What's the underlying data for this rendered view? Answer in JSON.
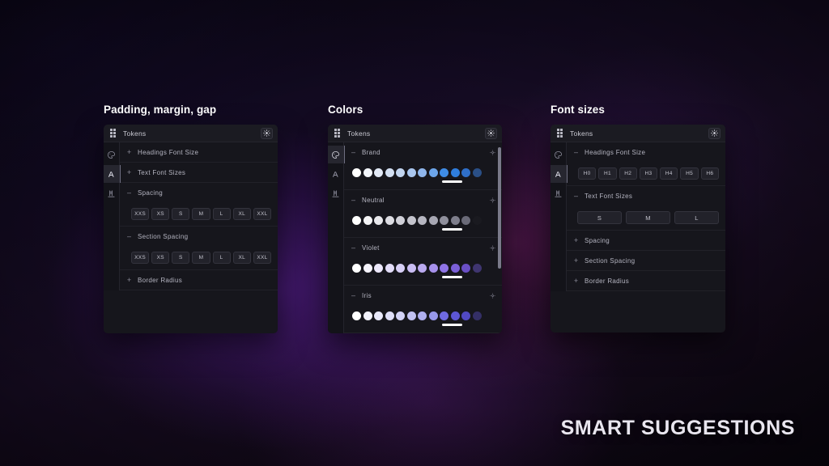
{
  "footer": {
    "text": "SMART SUGGESTIONS"
  },
  "theme": {
    "accent": "#ffffff",
    "panel_bg": "#16161c",
    "panel_header_bg": "#1b1b22",
    "rail_bg": "#131319",
    "border": "#212128",
    "text_primary": "#c9c9d2",
    "text_secondary": "#b4b4c0"
  },
  "panels": [
    {
      "caption": "Padding, margin, gap",
      "header": {
        "title": "Tokens",
        "grip_icon": "grid-dots-icon",
        "theme_icon": "sun-brightness-icon"
      },
      "rail": [
        {
          "icon": "palette-icon",
          "active": false
        },
        {
          "icon": "font-size-icon",
          "active": true
        },
        {
          "icon": "spacing-ruler-icon",
          "active": false
        }
      ],
      "rows": [
        {
          "toggle": "+",
          "label": "Headings Font Size"
        },
        {
          "toggle": "+",
          "label": "Text Font Sizes"
        },
        {
          "toggle": "–",
          "label": "Spacing"
        },
        {
          "toggle": "–",
          "label": "Section Spacing"
        },
        {
          "toggle": "+",
          "label": "Border Radius"
        }
      ],
      "spacing_chips": [
        "XXS",
        "XS",
        "S",
        "M",
        "L",
        "XL",
        "XXL"
      ],
      "section_spacing_chips": [
        "XXS",
        "XS",
        "S",
        "M",
        "L",
        "XL",
        "XXL"
      ]
    },
    {
      "caption": "Colors",
      "header": {
        "title": "Tokens",
        "grip_icon": "grid-dots-icon",
        "theme_icon": "sun-brightness-icon"
      },
      "rail": [
        {
          "icon": "palette-icon",
          "active": true
        },
        {
          "icon": "font-size-icon",
          "active": false
        },
        {
          "icon": "spacing-ruler-icon",
          "active": false
        }
      ],
      "groups": [
        {
          "toggle": "–",
          "label": "Brand",
          "reset_icon": "reset-target-icon",
          "selected_index": 8,
          "swatches": [
            "#ffffff",
            "#f2f5fb",
            "#e2e9f6",
            "#d3e0f3",
            "#c2d5f0",
            "#a9c6ef",
            "#8fb6ec",
            "#6ca5ea",
            "#3f8ce6",
            "#2f7ede",
            "#2f6fc9",
            "#2a4f86"
          ]
        },
        {
          "toggle": "–",
          "label": "Neutral",
          "reset_icon": "reset-target-icon",
          "selected_index": 8,
          "swatches": [
            "#ffffff",
            "#f4f4f6",
            "#e8e8ec",
            "#dcdce2",
            "#d0d0d8",
            "#c4c4cd",
            "#b6b6c1",
            "#a7a7b3",
            "#8f8f9c",
            "#7e7e8c",
            "#6a6a78",
            "#1a1a20"
          ]
        },
        {
          "toggle": "–",
          "label": "Violet",
          "reset_icon": "reset-target-icon",
          "selected_index": 8,
          "swatches": [
            "#ffffff",
            "#f6f4fd",
            "#ece8fb",
            "#e2dcf8",
            "#d7cff6",
            "#c9bdf3",
            "#b9a9ef",
            "#a791ec",
            "#8f74e6",
            "#7b5fd8",
            "#6a4fc6",
            "#3f3570"
          ]
        },
        {
          "toggle": "–",
          "label": "Iris",
          "reset_icon": "reset-target-icon",
          "selected_index": 8,
          "swatches": [
            "#ffffff",
            "#f3f3fd",
            "#e9e9fb",
            "#dedef8",
            "#d2d2f6",
            "#c2c2f2",
            "#aeaeee",
            "#9898ea",
            "#6f6ae0",
            "#5d56d4",
            "#5149c2",
            "#342f66"
          ]
        }
      ]
    },
    {
      "caption": "Font sizes",
      "header": {
        "title": "Tokens",
        "grip_icon": "grid-dots-icon",
        "theme_icon": "sun-brightness-icon"
      },
      "rail": [
        {
          "icon": "palette-icon",
          "active": false
        },
        {
          "icon": "font-size-icon",
          "active": true
        },
        {
          "icon": "spacing-ruler-icon",
          "active": false
        }
      ],
      "rows": [
        {
          "toggle": "–",
          "label": "Headings Font Size"
        },
        {
          "toggle": "–",
          "label": "Text Font Sizes"
        },
        {
          "toggle": "+",
          "label": "Spacing"
        },
        {
          "toggle": "+",
          "label": "Section Spacing"
        },
        {
          "toggle": "+",
          "label": "Border Radius"
        }
      ],
      "heading_chips": [
        "H0",
        "H1",
        "H2",
        "H3",
        "H4",
        "H5",
        "H6"
      ],
      "text_chips": [
        "S",
        "M",
        "L"
      ]
    }
  ]
}
